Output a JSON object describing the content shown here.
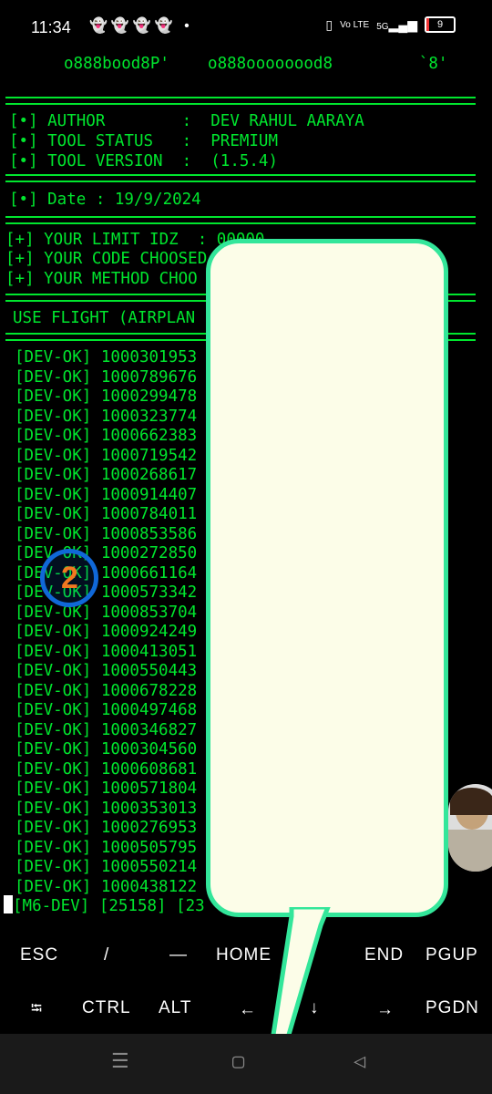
{
  "status_bar": {
    "time": "11:34",
    "notifications": "👻👻👻👻 •",
    "network": "Vo LTE",
    "signal": "5G",
    "battery": "9"
  },
  "terminal": {
    "banner": "o888bood8P'    o888oooooood8         `8'",
    "author": "[•] AUTHOR        :  DEV RAHUL AARAYA",
    "status": "[•] TOOL STATUS   :  PREMIUM",
    "version": "[•] TOOL VERSION  :  (1.5.4)",
    "date": "[•] Date : 19/9/2024",
    "limit": "[+] YOUR LIMIT IDZ  : 00000",
    "code": "[+] YOUR CODE CHOOSED",
    "method": "[+] YOUR METHOD CHOO",
    "airplane": "USE FLIGHT (AIRPLAN",
    "results": [
      "[DEV-OK] 1000301953",
      "[DEV-OK] 1000789676",
      "[DEV-OK] 1000299478",
      "[DEV-OK] 1000323774",
      "[DEV-OK] 1000662383",
      "[DEV-OK] 1000719542",
      "[DEV-OK] 1000268617",
      "[DEV-OK] 1000914407",
      "[DEV-OK] 1000784011",
      "[DEV-OK] 1000853586",
      "[DEV-OK] 1000272850",
      "[DEV-OK] 1000661164",
      "[DEV-OK] 1000573342",
      "[DEV-OK] 1000853704",
      "[DEV-OK] 1000924249",
      "[DEV-OK] 1000413051",
      "[DEV-OK] 1000550443",
      "[DEV-OK] 1000678228",
      "[DEV-OK] 1000497468",
      "[DEV-OK] 1000346827",
      "[DEV-OK] 1000304560",
      "[DEV-OK] 1000608681",
      "[DEV-OK] 1000571804",
      "[DEV-OK] 1000353013",
      "[DEV-OK] 1000276953",
      "[DEV-OK] 1000505795",
      "[DEV-OK] 1000550214",
      "[DEV-OK] 1000438122"
    ],
    "prompt": "[M6-DEV] [25158] [23"
  },
  "extra_keys": {
    "row1": [
      "ESC",
      "/",
      "—",
      "HOME",
      "END",
      "PGUP"
    ],
    "row2": [
      "⭾",
      "CTRL",
      "ALT",
      "←",
      "↓",
      "→",
      "PGDN"
    ]
  },
  "overlay": {
    "badge_number": "2"
  },
  "navigation": {
    "recents": "☰",
    "home": "▢",
    "back": "◁"
  },
  "colors": {
    "terminal_text": "#00e62e",
    "bubble_fill": "#fcfde8",
    "bubble_border": "#33e69a"
  }
}
